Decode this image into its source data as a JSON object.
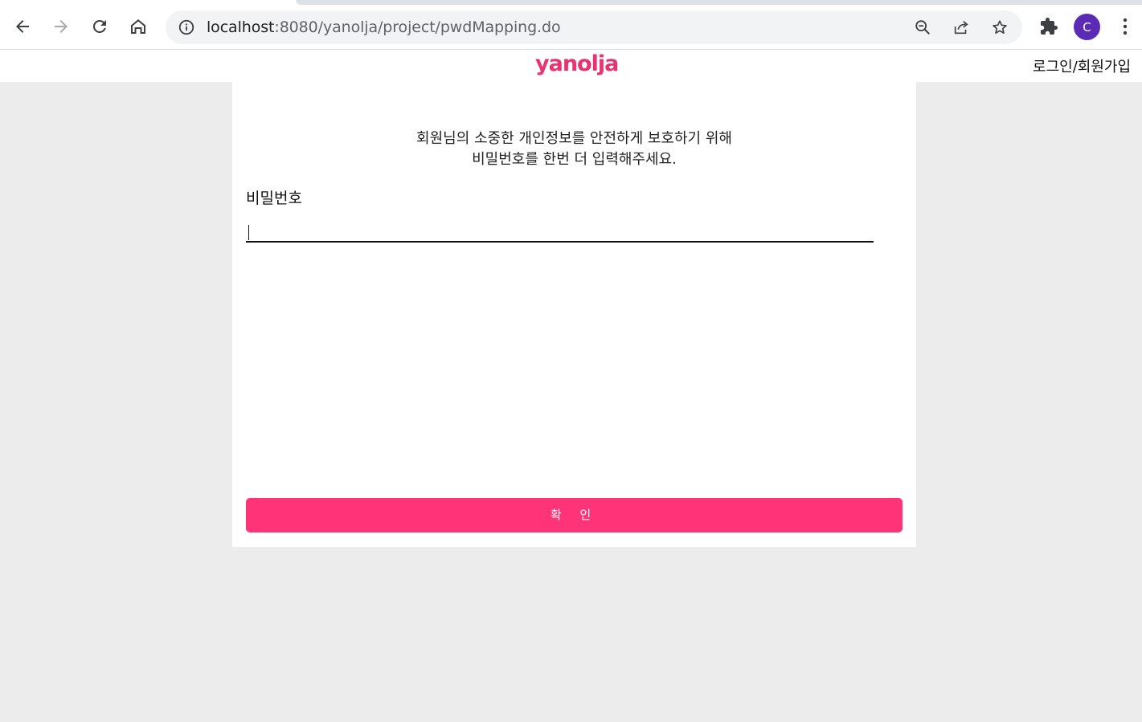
{
  "browser": {
    "url_host": "localhost",
    "url_path": ":8080/yanolja/project/pwdMapping.do",
    "profile_initial": "C",
    "colors": {
      "profile_avatar": "#5b2bb5",
      "omnibox_bg": "#f1f3f4"
    },
    "icons": {
      "back": "arrow-left-icon",
      "forward": "arrow-right-icon",
      "reload": "reload-icon",
      "home": "home-icon",
      "site_info": "info-icon",
      "zoom": "zoom-out-icon",
      "share": "share-icon",
      "bookmark": "star-icon",
      "extensions": "puzzle-icon",
      "menu": "kebab-menu-icon"
    }
  },
  "header": {
    "logo_text": "yanolja",
    "login_link": "로그인/회원가입",
    "colors": {
      "brand": "#e8336e"
    }
  },
  "form": {
    "notice_line1": "회원님의 소중한 개인정보를 안전하게 보호하기 위해",
    "notice_line2": "비밀번호를 한번 더 입력해주세요.",
    "password_label": "비밀번호",
    "password_value": "",
    "confirm_button": "확 인",
    "colors": {
      "button_bg": "#ff3478",
      "page_bg": "#ececec"
    }
  }
}
